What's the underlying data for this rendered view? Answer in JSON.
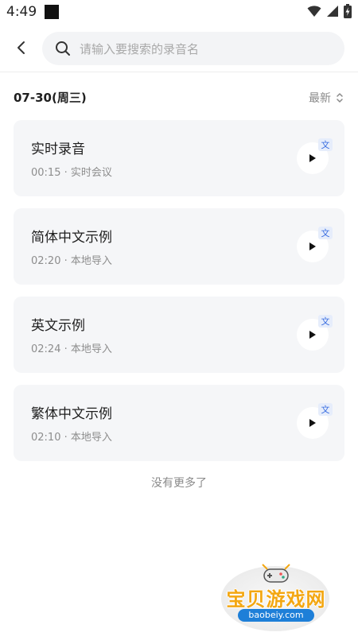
{
  "status_bar": {
    "time": "4:49",
    "icons": [
      "notification-square-icon",
      "wifi-icon",
      "signal-icon",
      "battery-charging-icon"
    ]
  },
  "search": {
    "placeholder": "请输入要搜索的录音名",
    "value": ""
  },
  "date_group": {
    "label": "07-30(周三)",
    "sort_label": "最新"
  },
  "recordings": [
    {
      "title": "实时录音",
      "meta": "00:15 · 实时会议",
      "badge": "文"
    },
    {
      "title": "简体中文示例",
      "meta": "02:20 · 本地导入",
      "badge": "文"
    },
    {
      "title": "英文示例",
      "meta": "02:24 · 本地导入",
      "badge": "文"
    },
    {
      "title": "繁体中文示例",
      "meta": "02:10 · 本地导入",
      "badge": "文"
    }
  ],
  "footer": {
    "no_more": "没有更多了"
  },
  "watermark": {
    "text": "宝贝游戏网",
    "url": "baobeiy.com"
  },
  "colors": {
    "card_bg": "#f5f6f8",
    "badge_text": "#3a6ee0",
    "watermark_orange": "#f3a712",
    "watermark_blue": "#1e7fd8"
  }
}
